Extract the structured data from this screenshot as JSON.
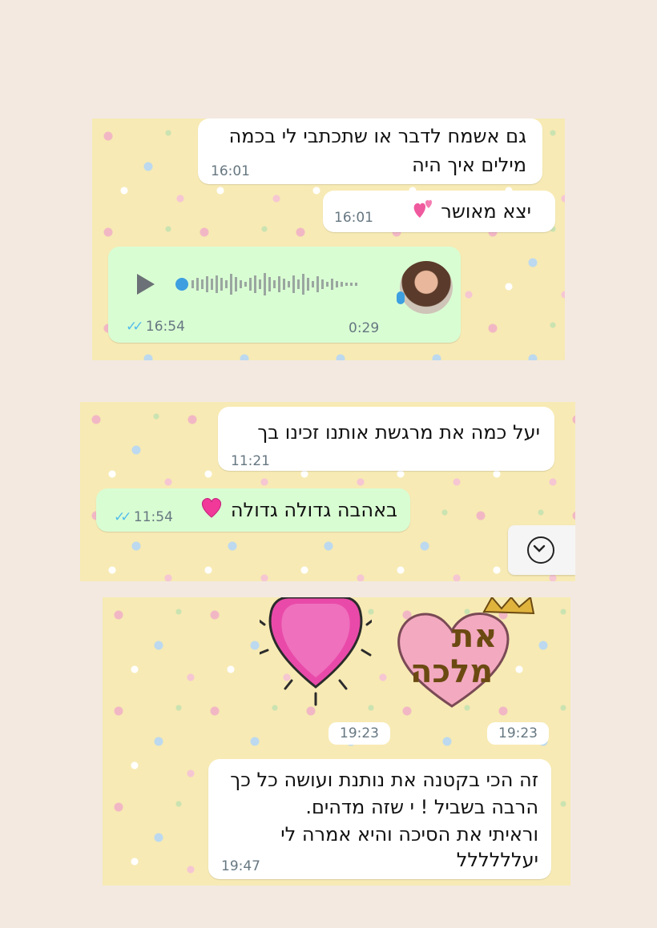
{
  "screenshot1": {
    "msg1": {
      "line1": "גם אשמח לדבר או שתכתבי לי בכמה",
      "line2": "מילים איך היה",
      "time": "16:01"
    },
    "msg2": {
      "text": "יצא מאושר",
      "time": "16:01"
    },
    "voice": {
      "duration": "0:29",
      "time": "16:54"
    }
  },
  "screenshot2": {
    "msg1": {
      "text": "יעל כמה את מרגשת אותנו זכינו בך",
      "time": "11:21"
    },
    "msg2": {
      "text": "באהבה גדולה גדולה",
      "time": "11:54"
    }
  },
  "screenshot3": {
    "sticker_left_time": "19:23",
    "sticker_right_time": "19:23",
    "sticker_right_text_line1": "את",
    "sticker_right_text_line2": "מלכה",
    "msg": {
      "line1": "זה הכי בקטנה את נותנת ועושה כל כך",
      "line2": "הרבה בשביל ! י שזה מדהים.",
      "line3": "וראיתי את הסיכה והיא אמרה לי",
      "line4": "יעלללללל",
      "time": "19:47"
    }
  },
  "colors": {
    "chat_bg": "#f7eab4",
    "sent_bubble": "#d9fdd3",
    "read_ticks": "#53bdeb"
  },
  "icons": [
    "play-icon",
    "waveform-icon",
    "mic-icon",
    "double-check-icon",
    "chevron-down-icon",
    "heart-emoji-icon",
    "heart-sticker",
    "queen-sticker"
  ]
}
